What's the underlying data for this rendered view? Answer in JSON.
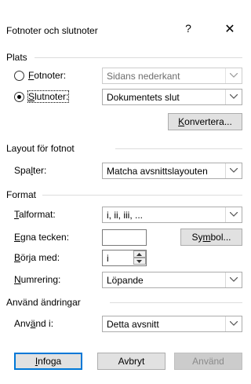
{
  "dialog": {
    "title": "Fotnoter och slutnoter",
    "help_glyph": "?",
    "close_glyph": "✕"
  },
  "plats": {
    "heading": "Plats",
    "footnotes_label": "Fotnoter:",
    "footnotes_value": "Sidans nederkant",
    "endnotes_label": "Slutnoter:",
    "endnotes_value": "Dokumentets slut",
    "selected": "endnotes",
    "convert_button": "Konvertera..."
  },
  "layout": {
    "heading": "Layout för fotnot",
    "columns_label": "Spalter:",
    "columns_value": "Matcha avsnittslayouten"
  },
  "format": {
    "heading": "Format",
    "number_format_label": "Talformat:",
    "number_format_value": "i, ii, iii, ...",
    "custom_mark_label": "Egna tecken:",
    "custom_mark_value": "",
    "symbol_button": "Symbol...",
    "start_at_label": "Börja med:",
    "start_at_value": "i",
    "numbering_label": "Numrering:",
    "numbering_value": "Löpande"
  },
  "apply": {
    "heading": "Använd ändringar",
    "apply_to_label": "Använd i:",
    "apply_to_value": "Detta avsnitt"
  },
  "buttons": {
    "insert": "Infoga",
    "cancel": "Avbryt",
    "apply": "Använd"
  }
}
